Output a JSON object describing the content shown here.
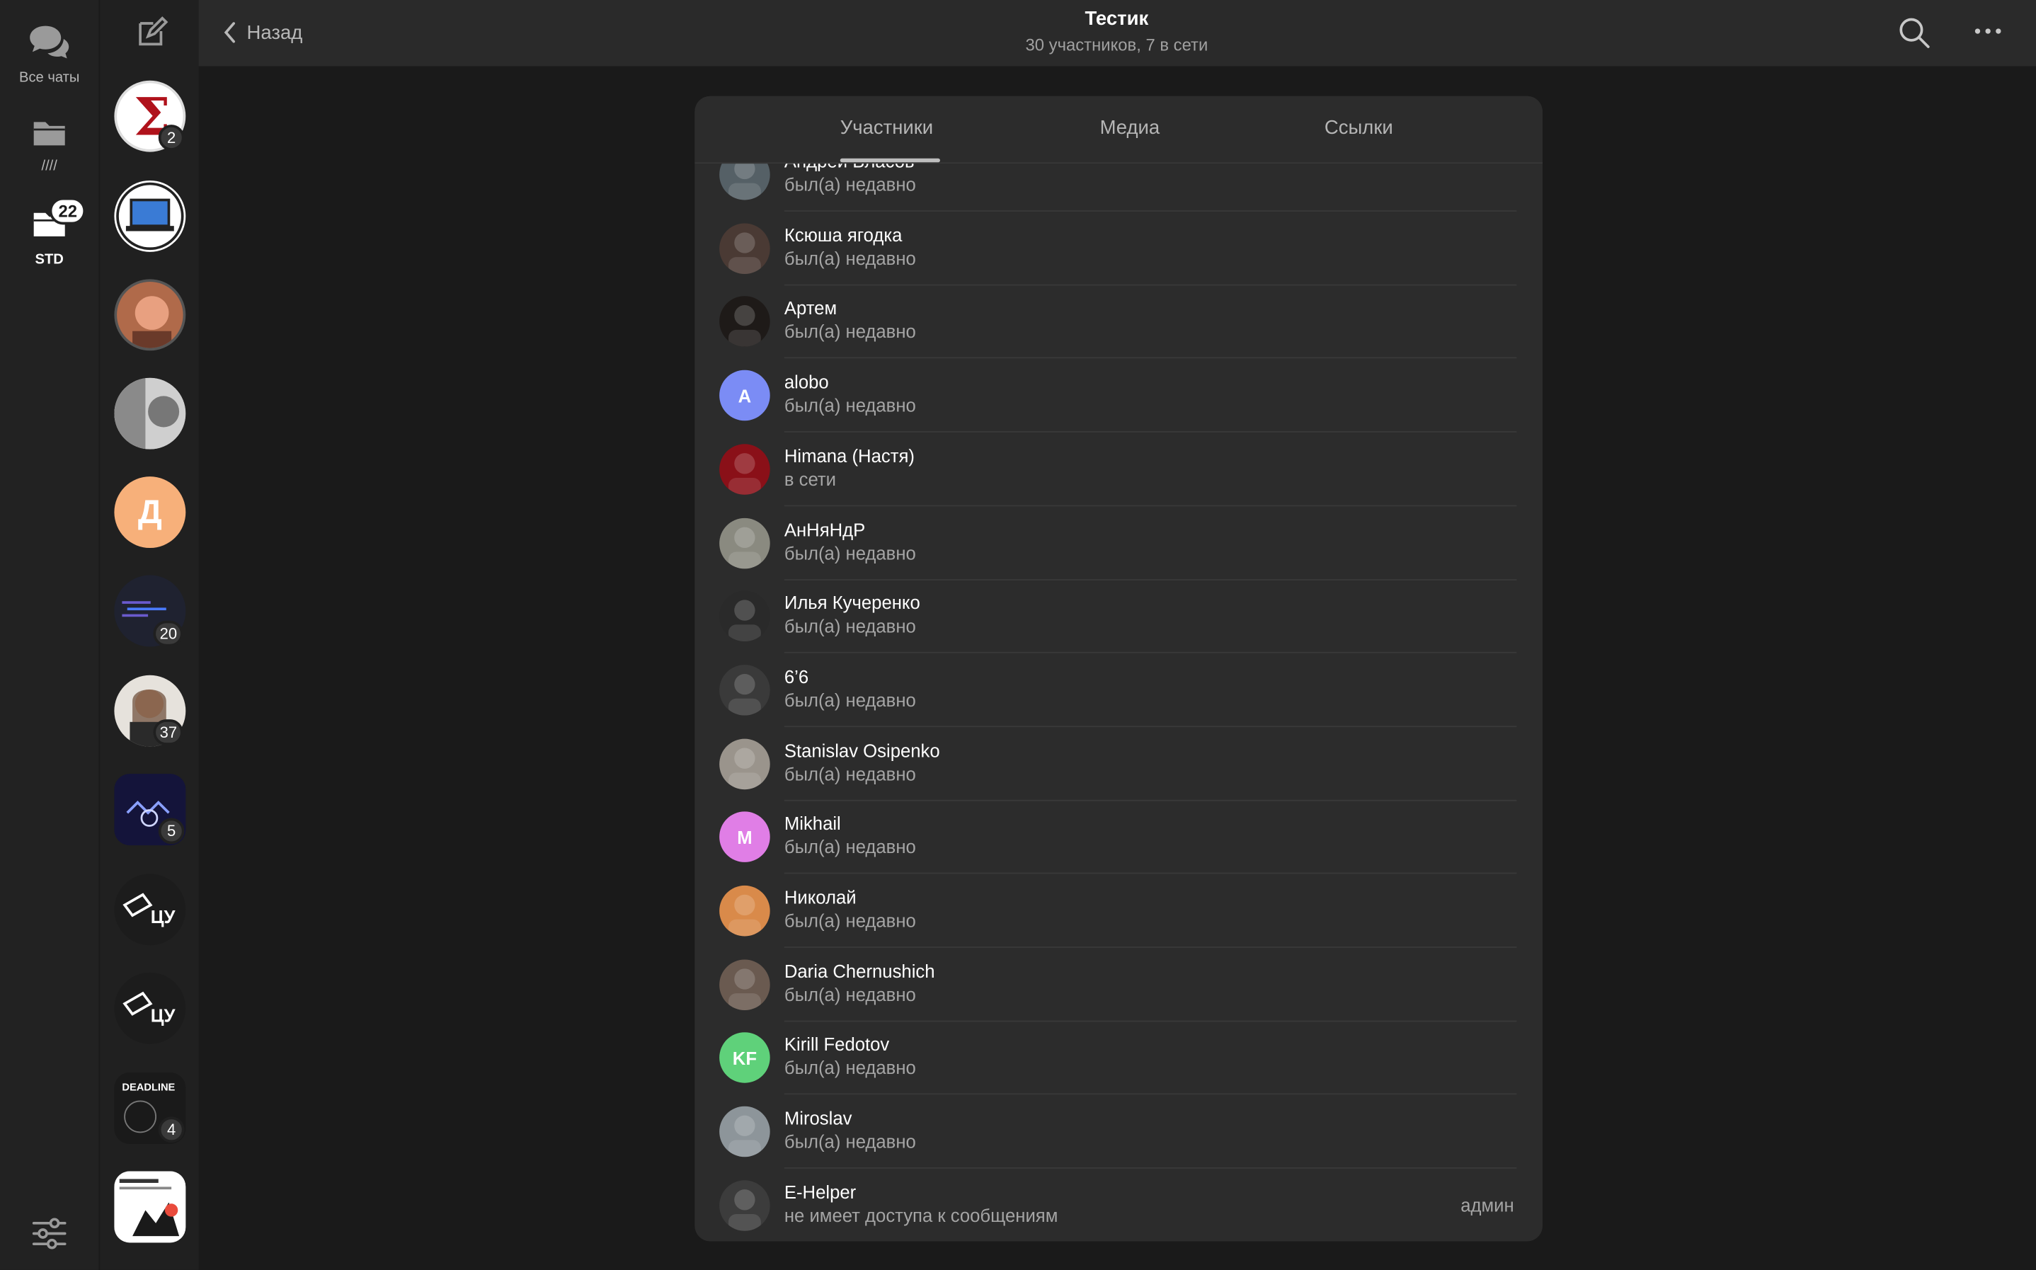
{
  "folders": [
    {
      "label": "Все чаты",
      "icon": "chats-icon"
    },
    {
      "label": "////",
      "icon": "folder-icon"
    },
    {
      "label": "STD",
      "icon": "folder-icon",
      "badge": "22"
    }
  ],
  "chat_list": {
    "badges": [
      "2",
      "20",
      "37",
      "5",
      "4"
    ]
  },
  "header": {
    "back_label": "Назад",
    "title": "Тестик",
    "subtitle": "30 участников, 7 в сети"
  },
  "tabs": [
    {
      "label": "Участники",
      "active": true
    },
    {
      "label": "Медиа",
      "active": false
    },
    {
      "label": "Ссылки",
      "active": false
    }
  ],
  "members": [
    {
      "name": "Андрей Власов",
      "status": "был(а) недавно",
      "avatar_color": "#556066"
    },
    {
      "name": "Ксюша ягодка",
      "status": "был(а) недавно",
      "avatar_color": "#4a3a34"
    },
    {
      "name": "Артем",
      "status": "был(а) недавно",
      "avatar_color": "#1e1a18"
    },
    {
      "name": "alobo",
      "status": "был(а) недавно",
      "avatar_letter": "A",
      "avatar_color": "#7b8cf5"
    },
    {
      "name": "Himana (Настя)",
      "status": "в сети",
      "avatar_color": "#8a1018"
    },
    {
      "name": "АнНяНдР",
      "status": "был(а) недавно",
      "avatar_color": "#8a8a80"
    },
    {
      "name": "Илья Кучеренко",
      "status": "был(а) недавно",
      "avatar_color": "#2a2a2a"
    },
    {
      "name": "6’6",
      "status": "был(а) недавно",
      "avatar_color": "#3a3a3a"
    },
    {
      "name": "Stanislav Osipenko",
      "status": "был(а) недавно",
      "avatar_color": "#9a948c"
    },
    {
      "name": "Mikhail",
      "status": "был(а) недавно",
      "avatar_letter": "M",
      "avatar_color": "#e07ee6"
    },
    {
      "name": "Николай",
      "status": "был(а) недавно",
      "avatar_color": "#d98a4a"
    },
    {
      "name": "Daria Chernushich",
      "status": "был(а) недавно",
      "avatar_color": "#6a5a50"
    },
    {
      "name": "Kirill Fedotov",
      "status": "был(а) недавно",
      "avatar_letter": "KF",
      "avatar_color": "#5fd17a"
    },
    {
      "name": "Miroslav",
      "status": "был(а) недавно",
      "avatar_color": "#8d959a"
    },
    {
      "name": "E-Helper",
      "status": "не имеет доступа к сообщениям",
      "role": "админ",
      "avatar_color": "#3c3c3c"
    }
  ],
  "colors": {
    "background": "#1a1a1a",
    "panel": "#2c2c2c",
    "topbar": "#2a2a2a",
    "secondary_text": "#a5a5a5"
  }
}
